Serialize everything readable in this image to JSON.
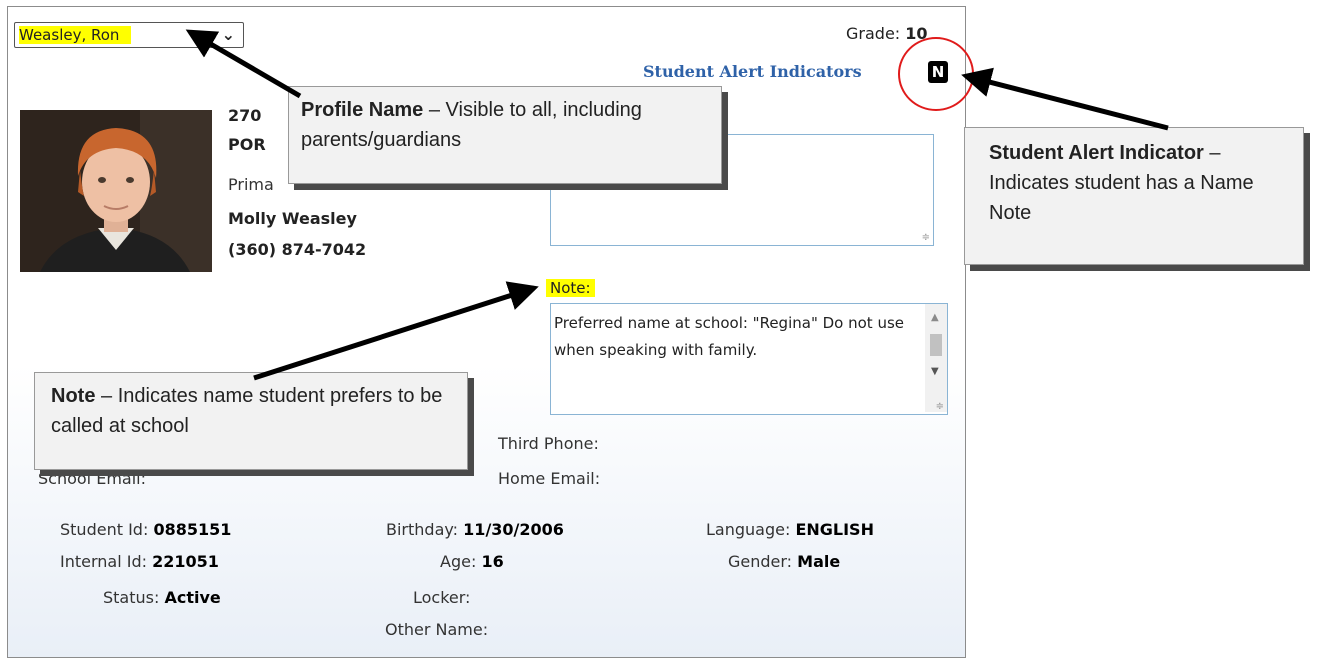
{
  "header": {
    "student_name": "Weasley, Ron",
    "grade_label": "Grade:",
    "grade_value": "10",
    "alert_indicators_label": "Student Alert Indicators",
    "alert_badge": "N"
  },
  "profile": {
    "address_line1_partial": "270",
    "address_line2_partial": "POR",
    "primary_guardian_label_partial": "Prima",
    "guardian_name": "Molly Weasley",
    "guardian_phone": "(360) 874-7042"
  },
  "note": {
    "label": "Note:",
    "text": "Preferred name at school: \"Regina\" Do not use when speaking with family."
  },
  "contact": {
    "third_phone_label": "Third Phone:",
    "home_email_label": "Home Email:",
    "school_email_label": "School Email:"
  },
  "details": {
    "student_id_label": "Student Id:",
    "student_id": "0885151",
    "internal_id_label": "Internal Id:",
    "internal_id": "221051",
    "status_label": "Status:",
    "status": "Active",
    "birthday_label": "Birthday:",
    "birthday": "11/30/2006",
    "age_label": "Age:",
    "age": "16",
    "locker_label": "Locker:",
    "other_name_label": "Other Name:",
    "language_label": "Language:",
    "language": "ENGLISH",
    "gender_label": "Gender:",
    "gender": "Male"
  },
  "callouts": {
    "profile_title": "Profile Name",
    "profile_text": "Visible to all, including parents/guardians",
    "alert_title": "Student Alert Indicator",
    "alert_text": "Indicates student has a Name Note",
    "note_title": "Note",
    "note_text": "Indicates name student prefers to be called at school",
    "separator": " – "
  },
  "icons": {
    "dropdown": "chevron-down-icon",
    "photo": "student-photo"
  },
  "colors": {
    "highlight": "#ffff00",
    "alert_label": "#2f62a8",
    "circle": "#e01b1b"
  }
}
